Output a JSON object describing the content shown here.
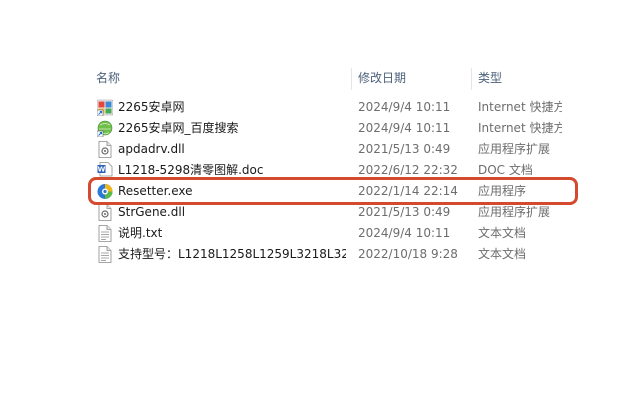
{
  "columns": {
    "name": "名称",
    "date": "修改日期",
    "type": "类型"
  },
  "files": [
    {
      "name": "2265安卓网",
      "date": "2024/9/4 10:11",
      "type": "Internet 快捷方式",
      "icon": "internet-shortcut-icon"
    },
    {
      "name": "2265安卓网_百度搜索",
      "date": "2024/9/4 10:11",
      "type": "Internet 快捷方式",
      "icon": "internet-shortcut-icon"
    },
    {
      "name": "apdadrv.dll",
      "date": "2021/5/13 0:49",
      "type": "应用程序扩展",
      "icon": "dll-file-icon"
    },
    {
      "name": "L1218-5298清零图解.doc",
      "date": "2022/6/12 22:32",
      "type": "DOC 文档",
      "icon": "word-doc-icon"
    },
    {
      "name": "Resetter.exe",
      "date": "2022/1/14 22:14",
      "type": "应用程序",
      "icon": "resetter-app-icon"
    },
    {
      "name": "StrGene.dll",
      "date": "2021/5/13 0:49",
      "type": "应用程序扩展",
      "icon": "dll-file-icon"
    },
    {
      "name": "说明.txt",
      "date": "2024/9/4 10:11",
      "type": "文本文档",
      "icon": "text-file-icon"
    },
    {
      "name": "支持型号：L1218L1258L1259L3218L32...",
      "date": "2022/10/18 9:28",
      "type": "文本文档",
      "icon": "text-file-icon"
    }
  ],
  "highlight_color": "#d34a2f"
}
